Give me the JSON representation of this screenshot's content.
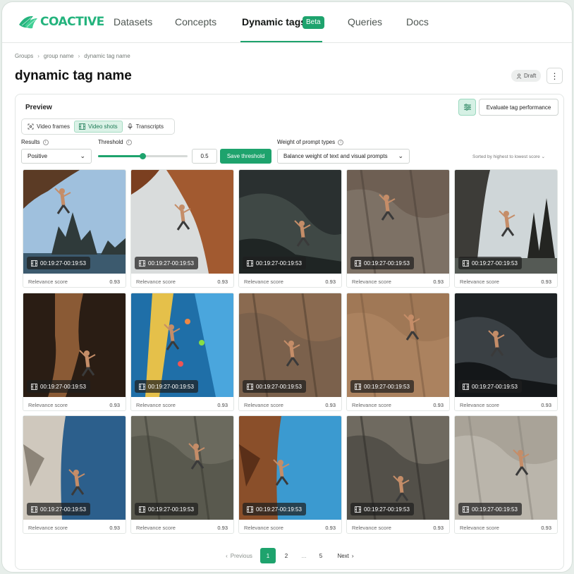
{
  "brand": {
    "name": "COACTIVE",
    "color": "#24b37d"
  },
  "nav": {
    "items": [
      {
        "label": "Datasets"
      },
      {
        "label": "Concepts"
      },
      {
        "label": "Dynamic tags",
        "badge": "Beta",
        "active": true
      },
      {
        "label": "Queries"
      },
      {
        "label": "Docs"
      }
    ]
  },
  "breadcrumb": [
    "Groups",
    "group name",
    "dynamic tag name"
  ],
  "page": {
    "title": "dynamic tag name",
    "status": "Draft"
  },
  "panel": {
    "title": "Preview",
    "evaluate_label": "Evaluate tag performance",
    "tabs": [
      {
        "label": "Video frames",
        "icon": "frame-icon"
      },
      {
        "label": "Video shots",
        "icon": "film-icon",
        "active": true
      },
      {
        "label": "Transcripts",
        "icon": "mic-icon"
      }
    ],
    "results": {
      "label": "Results",
      "value": "Positive"
    },
    "threshold": {
      "label": "Threshold",
      "value": "0.5",
      "level": 0.5,
      "save_label": "Save threshold"
    },
    "weight": {
      "label": "Weight of prompt types",
      "value": "Balance weight of text and visual prompts"
    },
    "sort_label": "Sorted by highest to lowest score"
  },
  "cards": [
    {
      "timecode": "00:19:27-00:19:53",
      "score_label": "Relevance score",
      "score": "0.93"
    },
    {
      "timecode": "00:19:27-00:19:53",
      "score_label": "Relevance score",
      "score": "0.93"
    },
    {
      "timecode": "00:19:27-00:19:53",
      "score_label": "Relevance score",
      "score": "0.93"
    },
    {
      "timecode": "00:19:27-00:19:53",
      "score_label": "Relevance score",
      "score": "0.93"
    },
    {
      "timecode": "00:19:27-00:19:53",
      "score_label": "Relevance score",
      "score": "0.93"
    },
    {
      "timecode": "00:19:27-00:19:53",
      "score_label": "Relevance score",
      "score": "0.93"
    },
    {
      "timecode": "00:19:27-00:19:53",
      "score_label": "Relevance score",
      "score": "0.93"
    },
    {
      "timecode": "00:19:27-00:19:53",
      "score_label": "Relevance score",
      "score": "0.93"
    },
    {
      "timecode": "00:19:27-00:19:53",
      "score_label": "Relevance score",
      "score": "0.93"
    },
    {
      "timecode": "00:19:27-00:19:53",
      "score_label": "Relevance score",
      "score": "0.93"
    },
    {
      "timecode": "00:19:27-00:19:53",
      "score_label": "Relevance score",
      "score": "0.93"
    },
    {
      "timecode": "00:19:27-00:19:53",
      "score_label": "Relevance score",
      "score": "0.93"
    },
    {
      "timecode": "00:19:27-00:19:53",
      "score_label": "Relevance score",
      "score": "0.93"
    },
    {
      "timecode": "00:19:27-00:19:53",
      "score_label": "Relevance score",
      "score": "0.93"
    },
    {
      "timecode": "00:19:27-00:19:53",
      "score_label": "Relevance score",
      "score": "0.93"
    }
  ],
  "pagination": {
    "previous": "Previous",
    "pages": [
      "1",
      "2",
      "...",
      "5"
    ],
    "current": "1",
    "next": "Next"
  },
  "colors": {
    "accent": "#1ea36d",
    "accent_light": "#dbf2e7"
  }
}
